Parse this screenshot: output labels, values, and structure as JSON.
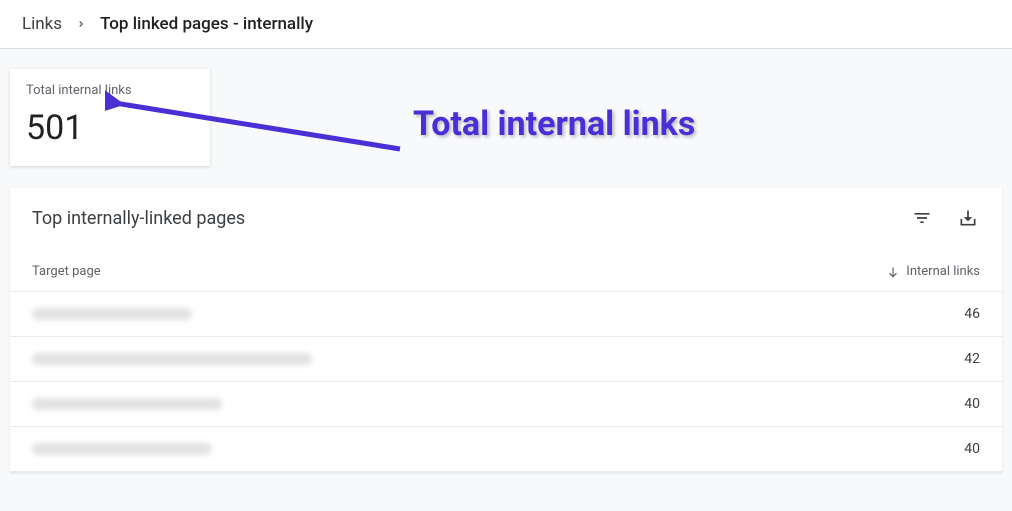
{
  "breadcrumb": {
    "root": "Links",
    "current": "Top linked pages - internally"
  },
  "stat": {
    "label": "Total internal links",
    "value": "501"
  },
  "annotation": {
    "text": "Total internal links"
  },
  "panel": {
    "title": "Top internally-linked pages",
    "columns": {
      "page": "Target page",
      "links": "Internal links"
    },
    "rows": [
      {
        "links": "46"
      },
      {
        "links": "42"
      },
      {
        "links": "40"
      },
      {
        "links": "40"
      }
    ]
  }
}
